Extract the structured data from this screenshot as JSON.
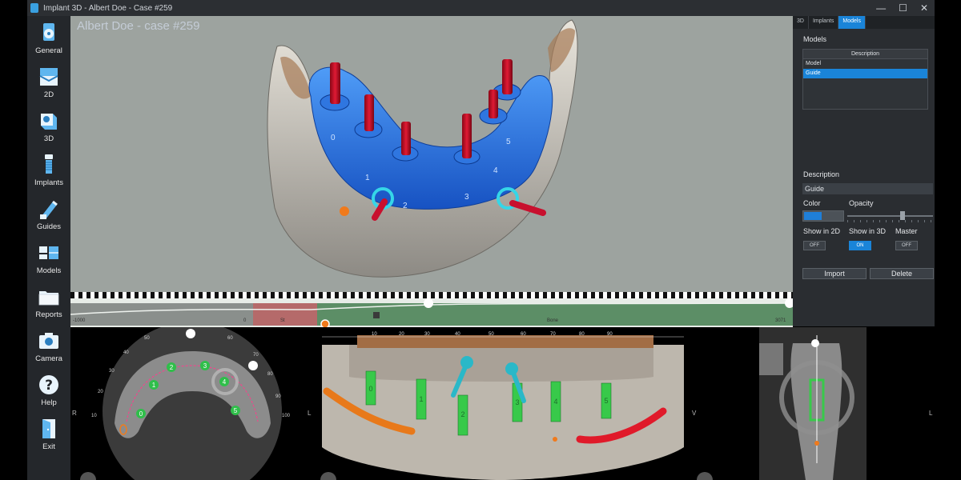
{
  "window": {
    "title": "Implant 3D - Albert Doe - Case #259",
    "min": "—",
    "max": "☐",
    "close": "✕"
  },
  "toolbar": {
    "items": [
      {
        "label": "General",
        "icon": "disc-icon"
      },
      {
        "label": "2D",
        "icon": "layers-2d-icon"
      },
      {
        "label": "3D",
        "icon": "cube-3d-icon"
      },
      {
        "label": "Implants",
        "icon": "implant-icon"
      },
      {
        "label": "Guides",
        "icon": "guide-icon"
      },
      {
        "label": "Models",
        "icon": "models-icon"
      },
      {
        "label": "Reports",
        "icon": "folder-icon"
      },
      {
        "label": "Camera",
        "icon": "camera-icon"
      },
      {
        "label": "Help",
        "icon": "help-icon"
      },
      {
        "label": "Exit",
        "icon": "exit-door-icon"
      }
    ]
  },
  "viewport": {
    "case_title": "Albert Doe - case #259",
    "implant_numbers": [
      "0",
      "1",
      "2",
      "3",
      "4",
      "5"
    ]
  },
  "density_strip": {
    "labels": [
      "-1000",
      "0",
      "St",
      "Bone",
      "3071"
    ]
  },
  "panel": {
    "tabs": [
      "3D",
      "Implants",
      "Models"
    ],
    "active_tab": "Models",
    "models_title": "Models",
    "column_header": "Description",
    "rows": [
      "Model",
      "Guide"
    ],
    "selected_row": "Guide",
    "description_title": "Description",
    "description_value": "Guide",
    "color_label": "Color",
    "opacity_label": "Opacity",
    "show2d_label": "Show in 2D",
    "show3d_label": "Show in 3D",
    "master_label": "Master",
    "show2d_state": "OFF",
    "show3d_state": "ON",
    "master_state": "OFF",
    "import_label": "Import",
    "delete_label": "Delete",
    "color": "#1f7fd8",
    "opacity_level": 0.65
  },
  "axial_view": {
    "side_left": "R",
    "side_right": "L",
    "ticks": [
      "10",
      "20",
      "30",
      "40",
      "50",
      "60",
      "70",
      "80",
      "90",
      "100"
    ],
    "implant_numbers": [
      "0",
      "1",
      "2",
      "3",
      "4",
      "5"
    ]
  },
  "panoramic_view": {
    "ticks": [
      "10",
      "20",
      "30",
      "40",
      "50",
      "60",
      "70",
      "80",
      "90"
    ],
    "implant_numbers": [
      "0",
      "1",
      "2",
      "3",
      "4",
      "5"
    ]
  },
  "cross_view": {
    "side_left": "V",
    "side_right": "L"
  }
}
